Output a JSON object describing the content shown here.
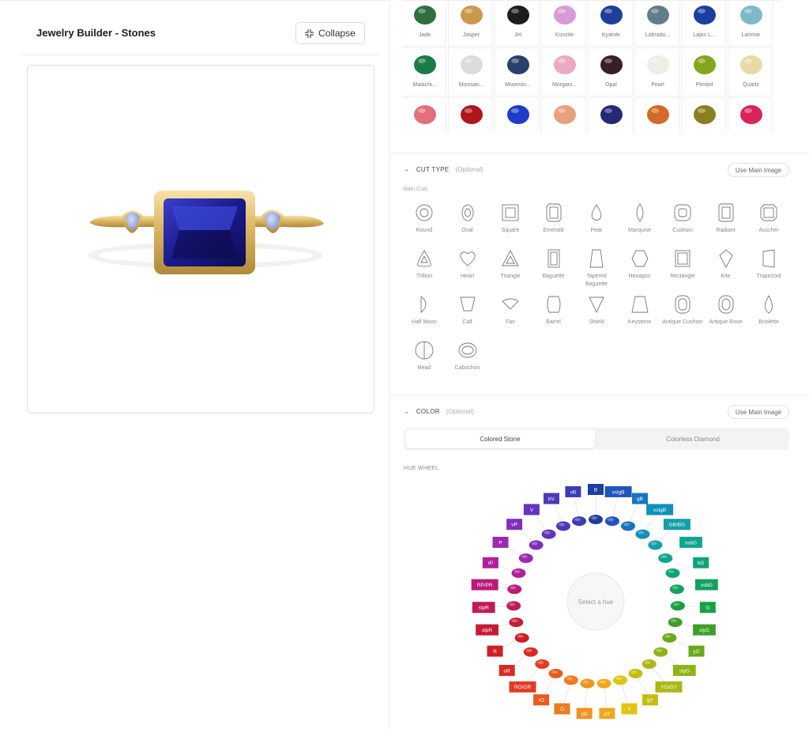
{
  "header": {
    "title": "Jewelry Builder - Stones",
    "collapse_label": "Collapse"
  },
  "stones": [
    {
      "label": "Jade",
      "color": "#2e6e3f"
    },
    {
      "label": "Jasper",
      "color": "#c99a4c"
    },
    {
      "label": "Jet",
      "color": "#1d1d1d"
    },
    {
      "label": "Kunzite",
      "color": "#d79bd6"
    },
    {
      "label": "Kyanite",
      "color": "#1f3f9a"
    },
    {
      "label": "Labrado...",
      "color": "#5f7d8a"
    },
    {
      "label": "Lapis L...",
      "color": "#1b3fa0"
    },
    {
      "label": "Larimar",
      "color": "#7fb8c9"
    },
    {
      "label": "Malachi...",
      "color": "#1c7a48"
    },
    {
      "label": "Moissan...",
      "color": "#dcdcdc"
    },
    {
      "label": "Moonsto...",
      "color": "#2b3f6b"
    },
    {
      "label": "Morgani...",
      "color": "#eaa9c3"
    },
    {
      "label": "Opal",
      "color": "#3a1c2a"
    },
    {
      "label": "Pearl",
      "color": "#f0ece6"
    },
    {
      "label": "Peridot",
      "color": "#86a51e"
    },
    {
      "label": "Quartz",
      "color": "#ead9a8"
    },
    {
      "label": "",
      "color": "#e36f7a"
    },
    {
      "label": "",
      "color": "#b0161e"
    },
    {
      "label": "",
      "color": "#1e3cc9"
    },
    {
      "label": "",
      "color": "#e8a07e"
    },
    {
      "label": "",
      "color": "#232a74"
    },
    {
      "label": "",
      "color": "#d46a28"
    },
    {
      "label": "",
      "color": "#8a8020"
    },
    {
      "label": "",
      "color": "#d9245a"
    }
  ],
  "cut_section": {
    "title": "CUT TYPE",
    "optional": "(Optional)",
    "use_main": "Use Main Image",
    "main_cuts": "Main Cuts"
  },
  "cuts": [
    {
      "label": "Round",
      "shape": "round"
    },
    {
      "label": "Oval",
      "shape": "oval"
    },
    {
      "label": "Square",
      "shape": "square"
    },
    {
      "label": "Emerald",
      "shape": "emerald"
    },
    {
      "label": "Pear",
      "shape": "pear"
    },
    {
      "label": "Marquise",
      "shape": "marquise"
    },
    {
      "label": "Cushion",
      "shape": "cushion"
    },
    {
      "label": "Radiant",
      "shape": "radiant"
    },
    {
      "label": "Asscher",
      "shape": "asscher"
    },
    {
      "label": "Trillion",
      "shape": "trillion"
    },
    {
      "label": "Heart",
      "shape": "heart"
    },
    {
      "label": "Triangle",
      "shape": "triangle"
    },
    {
      "label": "Baguette",
      "shape": "baguette"
    },
    {
      "label": "Tapered Baguette",
      "shape": "tapered"
    },
    {
      "label": "Hexagon",
      "shape": "hexagon"
    },
    {
      "label": "Rectangle",
      "shape": "rectangle"
    },
    {
      "label": "Kite",
      "shape": "kite"
    },
    {
      "label": "Trapezoid",
      "shape": "trapezoid"
    },
    {
      "label": "Half Moon",
      "shape": "halfmoon"
    },
    {
      "label": "Calf",
      "shape": "calf"
    },
    {
      "label": "Fan",
      "shape": "fan"
    },
    {
      "label": "Barrel",
      "shape": "barrel"
    },
    {
      "label": "Shield",
      "shape": "shield"
    },
    {
      "label": "Keystone",
      "shape": "keystone"
    },
    {
      "label": "Antique Cushion",
      "shape": "antique"
    },
    {
      "label": "Antique Rose",
      "shape": "antiquerose"
    },
    {
      "label": "Briolette",
      "shape": "briolette"
    },
    {
      "label": "Bead",
      "shape": "bead"
    },
    {
      "label": "Cabochon",
      "shape": "cabochon"
    }
  ],
  "color_section": {
    "title": "COLOR",
    "optional": "(Optional)",
    "use_main": "Use Main Image",
    "tab_colored": "Colored Stone",
    "tab_colorless": "Colorless Diamond",
    "hue_title": "HUE WHEEL",
    "center_label": "Select a hue"
  },
  "hues": [
    {
      "code": "B",
      "color": "#1f3f9e"
    },
    {
      "code": "vslgB",
      "color": "#1f55b8"
    },
    {
      "code": "gB",
      "color": "#1a72c2"
    },
    {
      "code": "vstgB",
      "color": "#1190b8"
    },
    {
      "code": "GB/BG",
      "color": "#12a0a8"
    },
    {
      "code": "vsbG",
      "color": "#10a58f"
    },
    {
      "code": "bG",
      "color": "#0fa378"
    },
    {
      "code": "vsbG",
      "color": "#12a25f"
    },
    {
      "code": "G",
      "color": "#18a045"
    },
    {
      "code": "slyG",
      "color": "#3d9e2c"
    },
    {
      "code": "yG",
      "color": "#6aa81c"
    },
    {
      "code": "styG",
      "color": "#8cb416"
    },
    {
      "code": "YG/GY",
      "color": "#aab914"
    },
    {
      "code": "gY",
      "color": "#c3bd12"
    },
    {
      "code": "Y",
      "color": "#e3c410"
    },
    {
      "code": "oY",
      "color": "#eea820"
    },
    {
      "code": "yO",
      "color": "#ef9322"
    },
    {
      "code": "O",
      "color": "#ee7a22"
    },
    {
      "code": "rO",
      "color": "#e85a22"
    },
    {
      "code": "RO/OR",
      "color": "#e03c24"
    },
    {
      "code": "oR",
      "color": "#d82a25"
    },
    {
      "code": "R",
      "color": "#cc1f26"
    },
    {
      "code": "slpR",
      "color": "#c41c3a"
    },
    {
      "code": "stpR",
      "color": "#c11a55"
    },
    {
      "code": "RP/PR",
      "color": "#bb1a78"
    },
    {
      "code": "rP",
      "color": "#b0209b"
    },
    {
      "code": "P",
      "color": "#9b28b2"
    },
    {
      "code": "vP",
      "color": "#7e30b9"
    },
    {
      "code": "V",
      "color": "#6236bb"
    },
    {
      "code": "bV",
      "color": "#4a39b8"
    },
    {
      "code": "vB",
      "color": "#3c3bb3"
    }
  ]
}
